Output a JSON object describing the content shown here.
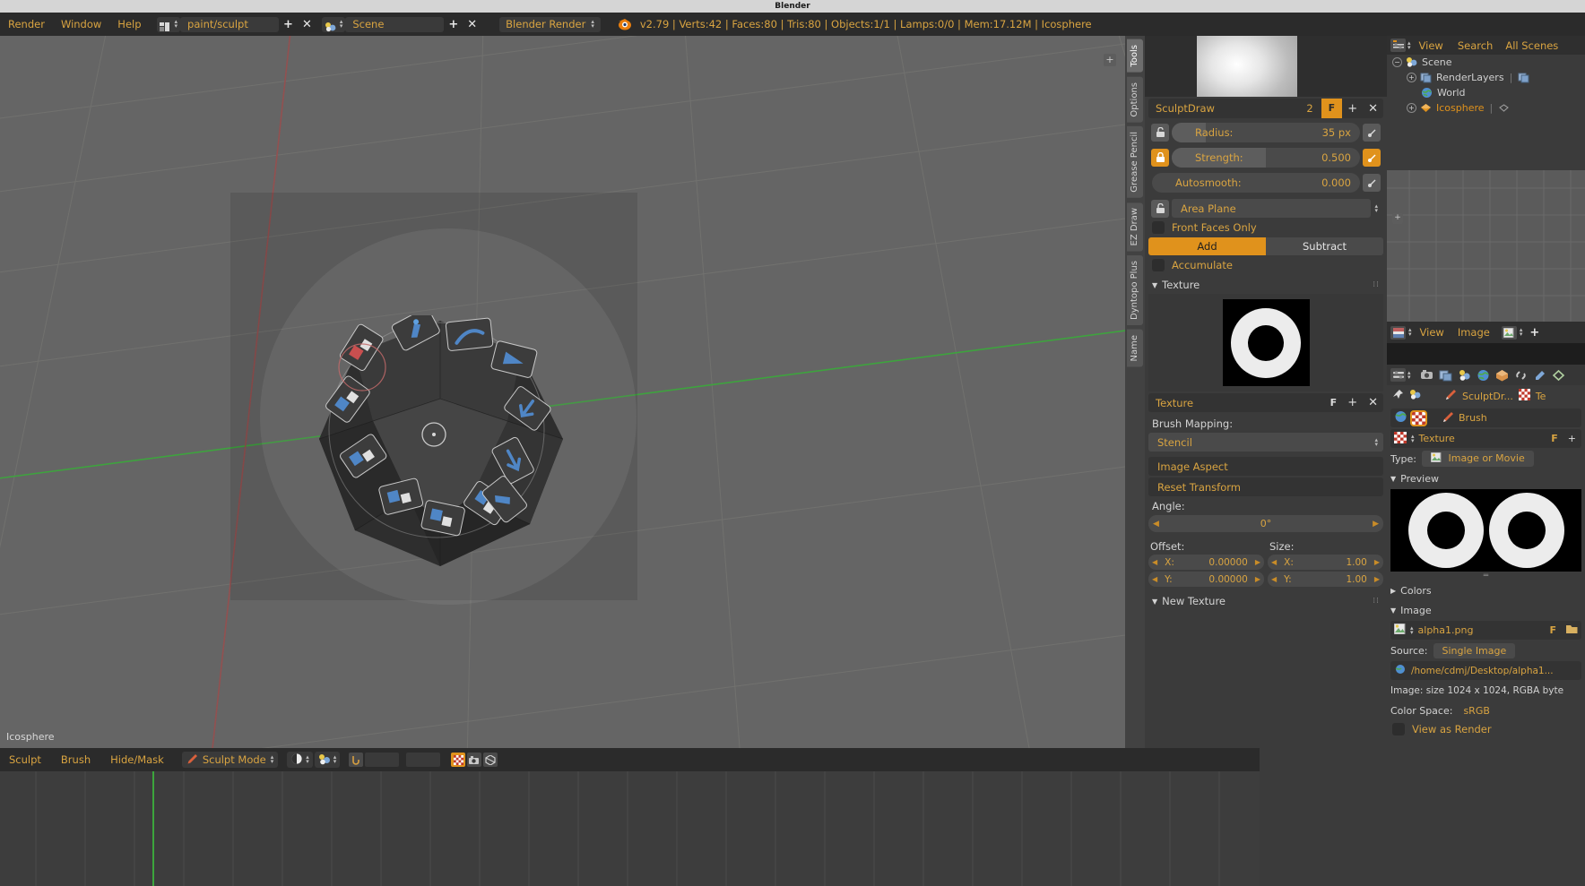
{
  "window": {
    "title": "Blender"
  },
  "topbar": {
    "menus": [
      "Render",
      "Window",
      "Help"
    ],
    "screen_layout": {
      "icon": "screen-layout-icon",
      "value": "paint/sculpt",
      "add": "+",
      "remove": "✕"
    },
    "scene": {
      "icon": "scene-icon",
      "value": "Scene",
      "add": "+",
      "remove": "✕"
    },
    "render_engine": "Blender Render",
    "stats": "v2.79 | Verts:42 | Faces:80 | Tris:80 | Objects:1/1 | Lamps:0/0 | Mem:17.12M | Icosphere"
  },
  "viewport": {
    "object_label": "Icosphere",
    "add_button": "+",
    "pie_menu": {
      "items": [
        "brush-draw",
        "brush-clay",
        "brush-crease",
        "brush-blob",
        "brush-flatten",
        "brush-inflate",
        "brush-grab",
        "brush-layer",
        "brush-mask",
        "brush-nudge",
        "brush-pinch",
        "brush-scrape",
        "brush-smooth",
        "brush-snake-hook"
      ]
    }
  },
  "tool_tabs": [
    {
      "label": "Tools",
      "active": true
    },
    {
      "label": "Options",
      "active": false
    },
    {
      "label": "Grease Pencil",
      "active": false
    },
    {
      "label": "EZ Draw",
      "active": false
    },
    {
      "label": "Dyntopo Plus",
      "active": false
    },
    {
      "label": "Name",
      "active": false
    }
  ],
  "tool_panel": {
    "brush": {
      "name": "SculptDraw",
      "users": "2",
      "fake_user": "F",
      "add": "+",
      "remove": "✕"
    },
    "radius": {
      "label": "Radius:",
      "value": "35 px",
      "lock": "unlocked",
      "fill_pct": 18
    },
    "strength": {
      "label": "Strength:",
      "value": "0.500",
      "lock": "locked",
      "fill_pct": 50
    },
    "autosmooth": {
      "label": "Autosmooth:",
      "value": "0.000",
      "fill_pct": 0
    },
    "area_plane": {
      "label": "Area Plane",
      "lock": "unlocked"
    },
    "front_faces_only": {
      "label": "Front Faces Only",
      "checked": false
    },
    "direction": {
      "add": "Add",
      "subtract": "Subtract",
      "selected": "Add"
    },
    "accumulate": {
      "label": "Accumulate",
      "checked": false
    },
    "texture_section": {
      "title": "Texture",
      "expanded": true,
      "thumb": "ring-texture",
      "datablock": {
        "name": "Texture",
        "fake_user": "F",
        "add": "+",
        "remove": "✕"
      },
      "brush_mapping_label": "Brush Mapping:",
      "brush_mapping_value": "Stencil",
      "image_aspect": "Image Aspect",
      "reset_transform": "Reset Transform",
      "angle_label": "Angle:",
      "angle_value": "0°",
      "offset_label": "Offset:",
      "offset": {
        "x_key": "X:",
        "x_val": "0.00000",
        "y_key": "Y:",
        "y_val": "0.00000"
      },
      "size_label": "Size:",
      "size": {
        "x_key": "X:",
        "x_val": "1.00",
        "y_key": "Y:",
        "y_val": "1.00"
      }
    },
    "new_texture_section": {
      "title": "New Texture",
      "expanded": true
    }
  },
  "outliner": {
    "header": {
      "display_icon": "outliner-icon",
      "menus": [
        "View",
        "Search"
      ],
      "scope": "All Scenes"
    },
    "rows": [
      {
        "label": "Scene",
        "icon": "scene-icon",
        "indent": 0,
        "expander": "−"
      },
      {
        "label": "RenderLayers",
        "icon": "renderlayers-icon",
        "indent": 1,
        "expander": "+"
      },
      {
        "label": "World",
        "icon": "world-icon",
        "indent": 1,
        "expander": ""
      },
      {
        "label": "Icosphere",
        "icon": "mesh-icon",
        "indent": 1,
        "expander": "+",
        "selected": true
      }
    ]
  },
  "uv_editor": {
    "header": {
      "editor_icon": "uv-image-editor-icon",
      "menus": [
        "View",
        "Image"
      ],
      "image_icon": "image-icon",
      "add": "+"
    },
    "add_button": "+"
  },
  "texture_properties": {
    "header": {
      "editor_icon": "properties-icon",
      "tabs": [
        "render-icon",
        "renderlayers-icon",
        "scene-icon",
        "world-icon",
        "object-icon",
        "constraints-icon",
        "modifiers-icon",
        "data-icon"
      ]
    },
    "breadcrumb": {
      "pin": "pin-icon",
      "scene_icon": "scene-icon",
      "brush_icon": "brush-icon",
      "brush_name": "SculptDr...",
      "texture_icon": "texture-icon",
      "texture_name": "Te"
    },
    "context_row": {
      "world_icon": "world-icon",
      "texture_icon": "texture-icon",
      "brush_icon": "brush-icon",
      "label": "Brush"
    },
    "datablock": {
      "icon": "texture-icon",
      "name": "Texture",
      "fake_user": "F",
      "add": "+"
    },
    "type_label": "Type:",
    "type_value": "Image or Movie",
    "type_icon": "image-icon",
    "preview_label": "Preview",
    "colors_label": "Colors",
    "image_label": "Image",
    "image_name": "alpha1.png",
    "image_fake_user": "F",
    "source_label": "Source:",
    "source_value": "Single Image",
    "path": "/home/cdmj/Desktop/alpha1...",
    "image_info": "Image: size 1024 x 1024, RGBA byte",
    "color_space_label": "Color Space:",
    "color_space_value": "sRGB",
    "view_as_render": "View as Render",
    "view_as_render_checked": false
  },
  "bottom_bar": {
    "menus": [
      "Sculpt",
      "Brush",
      "Hide/Mask"
    ],
    "mode": {
      "icon": "sculpt-mode-icon",
      "value": "Sculpt Mode"
    },
    "shading": {
      "icon": "solid-shading-icon"
    },
    "scene_icon": "scene-icon"
  },
  "colors": {
    "accent": "#e0921c",
    "text_orange": "#d9a441",
    "panel_bg": "#3b3b3b",
    "header_bg": "#2b2b2b",
    "viewport_bg": "#656565",
    "axis_green": "#3ca63c",
    "axis_red": "#9c4a4a"
  }
}
